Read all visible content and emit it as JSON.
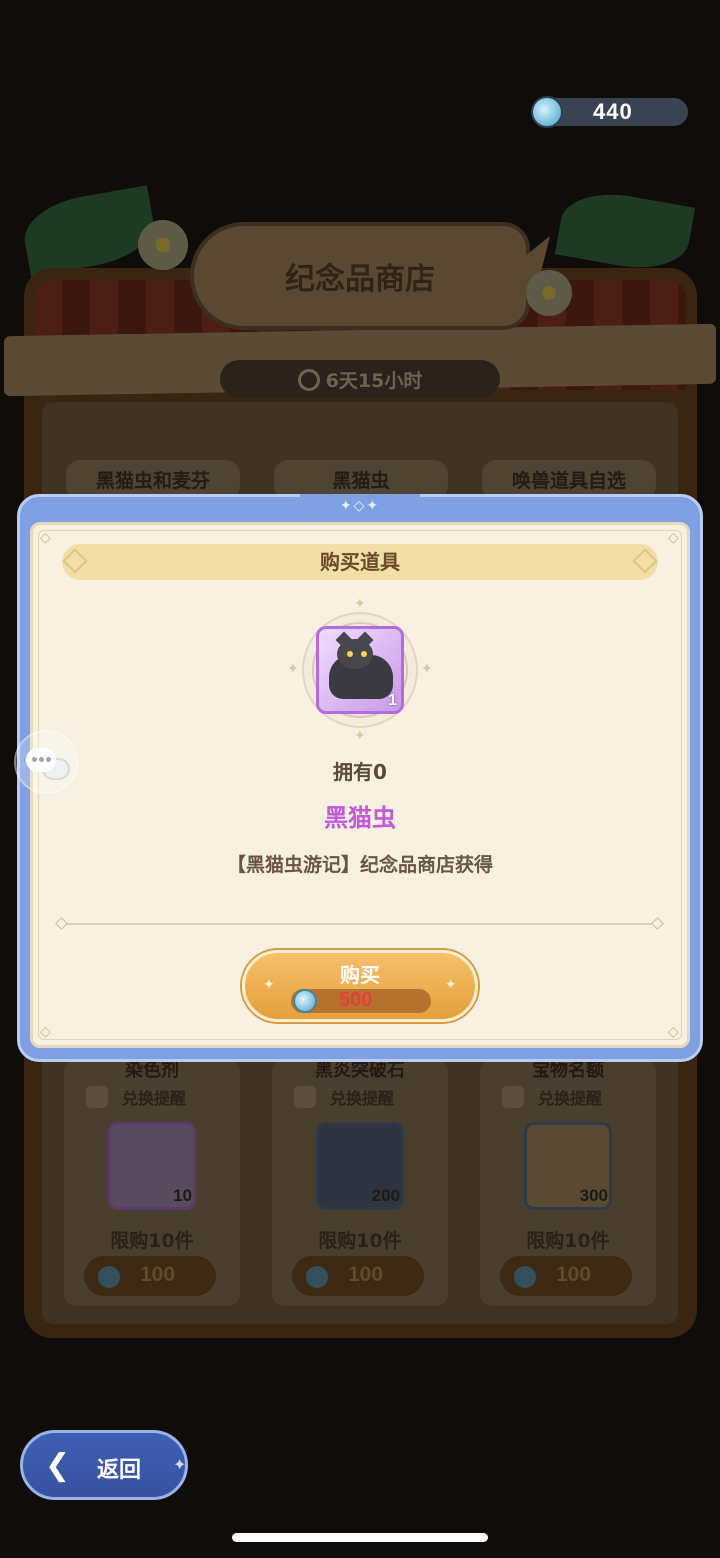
{
  "currency": {
    "amount": "440",
    "icon": "gem-icon"
  },
  "shop": {
    "title": "纪念品商店",
    "timer": "6天15小时",
    "tabs": [
      {
        "label": "黑猫虫和麦芬"
      },
      {
        "label": "黑猫虫"
      },
      {
        "label": "唤兽道具自选"
      }
    ],
    "items": [
      {
        "name": "染色剂",
        "remind_label": "兑换提醒",
        "quantity": "10",
        "limit": "限购10件",
        "price": "100"
      },
      {
        "name": "黑炎突破石",
        "remind_label": "兑换提醒",
        "quantity": "200",
        "limit": "限购10件",
        "price": "100"
      },
      {
        "name": "宝物名额",
        "remind_label": "兑换提醒",
        "quantity": "300",
        "limit": "限购10件",
        "price": "100"
      }
    ]
  },
  "modal": {
    "title": "购买道具",
    "item_count": "1",
    "owned": "拥有0",
    "item_name": "黑猫虫",
    "source": "【黑猫虫游记】纪念品商店获得",
    "buy_label": "购买",
    "price": "500",
    "price_color": "#e0423a",
    "name_color": "#c159d8"
  },
  "back_button": {
    "label": "返回"
  },
  "colors": {
    "modal_frame": "#7fa1e3",
    "button": "#e69f3c",
    "parchment": "#f8f1e2"
  }
}
